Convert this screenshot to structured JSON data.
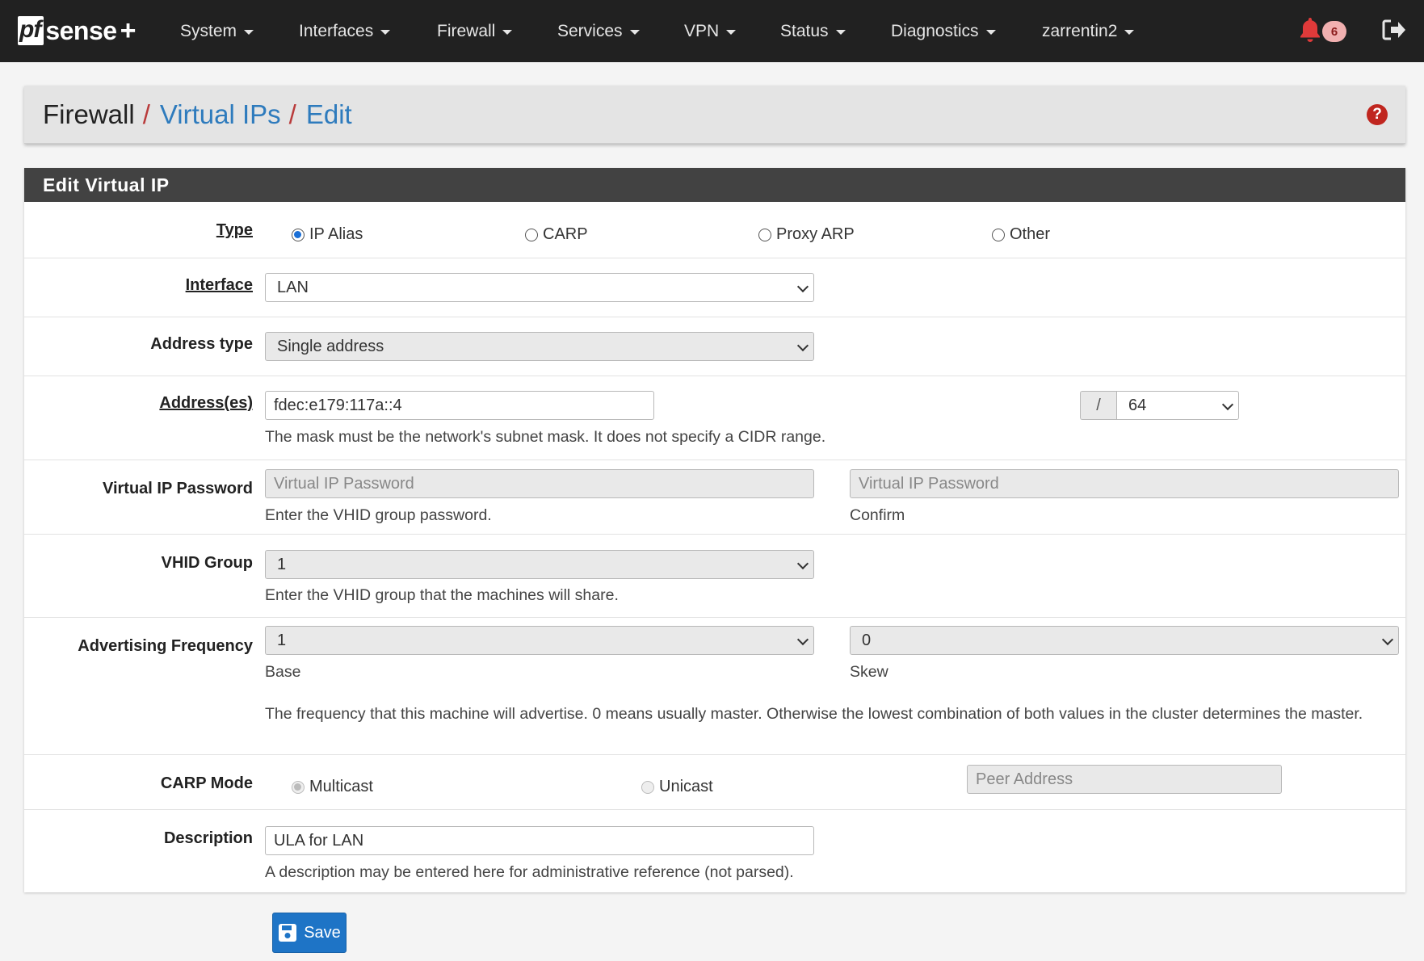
{
  "brand": {
    "pf": "pf",
    "sense": "sense",
    "plus": "+"
  },
  "nav": {
    "system": "System",
    "interfaces": "Interfaces",
    "firewall": "Firewall",
    "services": "Services",
    "vpn": "VPN",
    "status": "Status",
    "diagnostics": "Diagnostics",
    "user": "zarrentin2",
    "notifications": "6"
  },
  "breadcrumb": {
    "root": "Firewall",
    "parent": "Virtual IPs",
    "current": "Edit",
    "sep": "/",
    "help": "?"
  },
  "panel": {
    "title": "Edit Virtual IP"
  },
  "form": {
    "type": {
      "label": "Type",
      "options": [
        "IP Alias",
        "CARP",
        "Proxy ARP",
        "Other"
      ],
      "selected": "IP Alias"
    },
    "interface": {
      "label": "Interface",
      "value": "LAN"
    },
    "address_type": {
      "label": "Address type",
      "value": "Single address"
    },
    "address": {
      "label": "Address(es)",
      "value": "fdec:e179:117a::4",
      "mask_sep": "/",
      "mask": "64",
      "help": "The mask must be the network's subnet mask. It does not specify a CIDR range."
    },
    "password": {
      "label": "Virtual IP Password",
      "placeholder": "Virtual IP Password",
      "help": "Enter the VHID group password.",
      "confirm_placeholder": "Virtual IP Password",
      "confirm_help": "Confirm"
    },
    "vhid": {
      "label": "VHID Group",
      "value": "1",
      "help": "Enter the VHID group that the machines will share."
    },
    "adv_freq": {
      "label": "Advertising Frequency",
      "base": "1",
      "base_help": "Base",
      "skew": "0",
      "skew_help": "Skew",
      "help": "The frequency that this machine will advertise. 0 means usually master. Otherwise the lowest combination of both values in the cluster determines the master."
    },
    "carp_mode": {
      "label": "CARP Mode",
      "options": [
        "Multicast",
        "Unicast"
      ],
      "selected": "Multicast",
      "peer_placeholder": "Peer Address"
    },
    "description": {
      "label": "Description",
      "value": "ULA for LAN",
      "help": "A description may be entered here for administrative reference (not parsed)."
    }
  },
  "save_label": "Save",
  "colors": {
    "navbar": "#212121",
    "accent": "#2e7bbd",
    "danger": "#c0261f",
    "panel_head": "#424242",
    "button": "#1e74c6"
  }
}
